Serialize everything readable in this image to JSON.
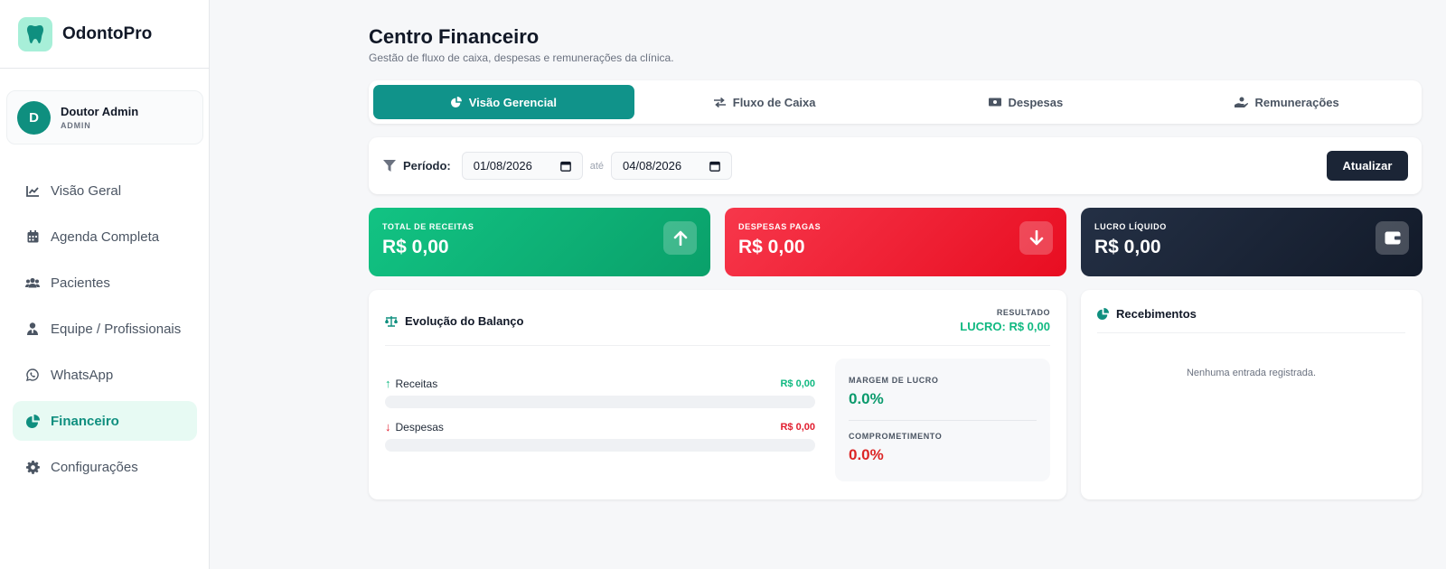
{
  "app": {
    "name": "OdontoPro"
  },
  "user": {
    "initial": "D",
    "name": "Doutor Admin",
    "role": "ADMIN"
  },
  "sidebar": {
    "items": [
      {
        "label": "Visão Geral",
        "icon": "chart-line-icon"
      },
      {
        "label": "Agenda Completa",
        "icon": "calendar-icon"
      },
      {
        "label": "Pacientes",
        "icon": "users-icon"
      },
      {
        "label": "Equipe / Profissionais",
        "icon": "user-tie-icon"
      },
      {
        "label": "WhatsApp",
        "icon": "whatsapp-icon"
      },
      {
        "label": "Financeiro",
        "icon": "pie-chart-icon",
        "active": true
      },
      {
        "label": "Configurações",
        "icon": "gear-icon"
      }
    ]
  },
  "header": {
    "title": "Centro Financeiro",
    "subtitle": "Gestão de fluxo de caixa, despesas e remunerações da clínica."
  },
  "tabs": [
    {
      "label": "Visão Gerencial",
      "icon": "pie-chart-icon",
      "active": true
    },
    {
      "label": "Fluxo de Caixa",
      "icon": "exchange-icon"
    },
    {
      "label": "Despesas",
      "icon": "money-bill-icon"
    },
    {
      "label": "Remunerações",
      "icon": "hand-coin-icon"
    }
  ],
  "filter": {
    "label": "Período:",
    "start_date": "01/08/2026",
    "separator": "até",
    "end_date": "04/08/2026",
    "button": "Atualizar"
  },
  "kpis": {
    "receitas": {
      "label": "TOTAL DE RECEITAS",
      "value": "R$ 0,00",
      "icon": "arrow-up-icon"
    },
    "despesas": {
      "label": "DESPESAS PAGAS",
      "value": "R$ 0,00",
      "icon": "arrow-down-icon"
    },
    "lucro": {
      "label": "LUCRO LÍQUIDO",
      "value": "R$ 0,00",
      "icon": "wallet-icon"
    }
  },
  "balance": {
    "title": "Evolução do Balanço",
    "result_label": "RESULTADO",
    "result_value": "LUCRO: R$ 0,00",
    "receitas": {
      "label": "Receitas",
      "amount": "R$ 0,00",
      "fill": 0
    },
    "despesas": {
      "label": "Despesas",
      "amount": "R$ 0,00",
      "fill": 0
    },
    "margem": {
      "label": "MARGEM DE LUCRO",
      "value": "0.0%"
    },
    "comprometimento": {
      "label": "COMPROMETIMENTO",
      "value": "0.0%"
    }
  },
  "recebimentos": {
    "title": "Recebimentos",
    "empty": "Nenhuma entrada registrada."
  },
  "colors": {
    "primary": "#10938a",
    "green": "#10b981",
    "red": "#e11d2e",
    "dark": "#1b2536"
  }
}
